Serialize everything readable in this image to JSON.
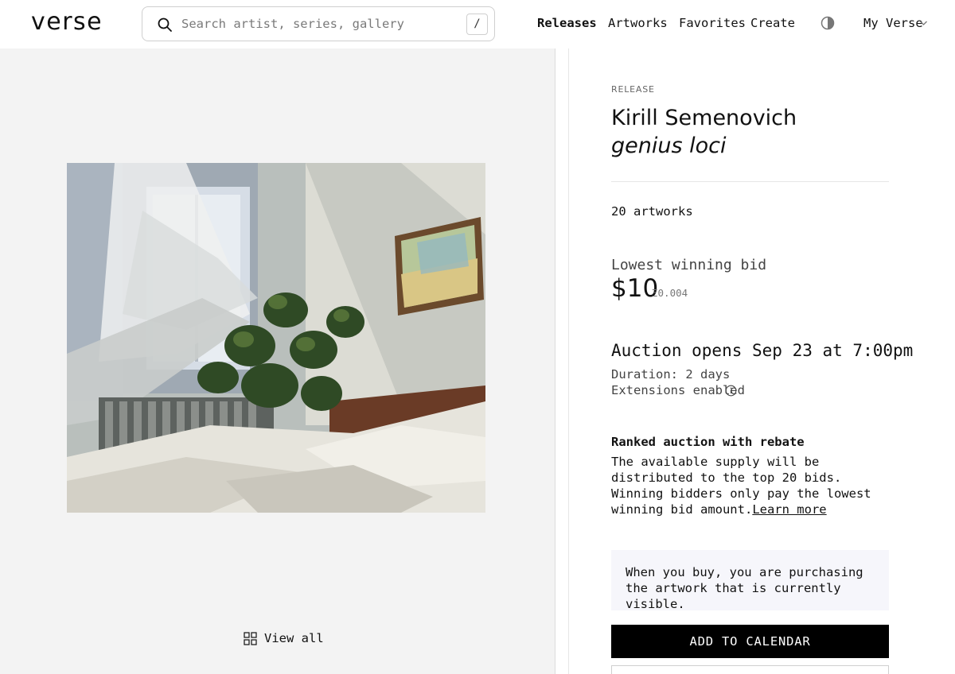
{
  "header": {
    "logo": "verse",
    "search_placeholder": "Search artist, series, gallery",
    "search_shortcut": "/",
    "nav": [
      "Releases",
      "Artworks",
      "Favorites",
      "Create"
    ],
    "account_label": "My Verse",
    "icons": [
      "search-icon",
      "theme-toggle-icon",
      "chevron-down-icon"
    ]
  },
  "left": {
    "view_all_label": "View all",
    "icons": [
      "grid-icon"
    ]
  },
  "release": {
    "kicker": "RELEASE",
    "artist": "Kirill Semenovich",
    "series": "genius loci",
    "artwork_count": "20 artworks",
    "bid_label": "Lowest winning bid",
    "bid_value": "$10",
    "bid_eth": "Ξ0.004",
    "auction_opens": "Auction opens Sep 23 at 7:00pm",
    "duration": "Duration: 2 days",
    "extensions": "Extensions enabled",
    "ranked_title": "Ranked auction with rebate",
    "ranked_desc": "The available supply will be distributed to the top 20 bids. Winning bidders only pay the lowest winning bid amount.",
    "learn_more": "Learn more",
    "notice": "When you buy, you are purchasing the artwork that is currently visible.",
    "cta_label": "ADD TO CALENDAR"
  },
  "colors": {
    "accent": "#000000",
    "panel_bg": "#f3f3f3",
    "notice_bg": "#f6f6fb"
  }
}
